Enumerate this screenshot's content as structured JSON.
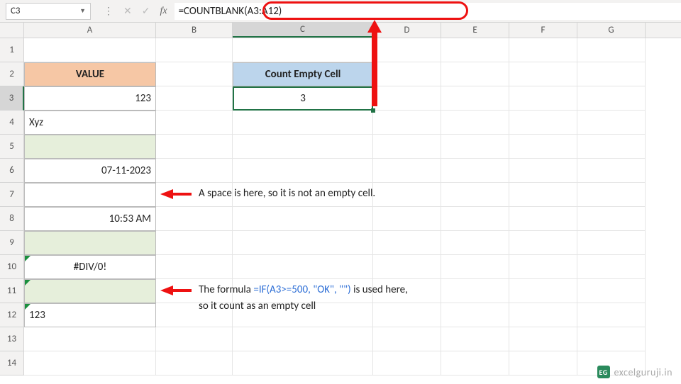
{
  "name_box": "C3",
  "formula_bar": "=COUNTBLANK(A3:A12)",
  "columns": [
    "A",
    "B",
    "C",
    "D",
    "E",
    "F",
    "G"
  ],
  "rows": [
    "1",
    "2",
    "3",
    "4",
    "5",
    "6",
    "7",
    "8",
    "9",
    "10",
    "11",
    "12",
    "13",
    "14"
  ],
  "headers": {
    "a2": "VALUE",
    "c2": "Count Empty Cell"
  },
  "cells": {
    "a3": "123",
    "a4": "Xyz",
    "a5": "",
    "a6": "07-11-2023",
    "a7": " ",
    "a8": "10:53 AM",
    "a9": "",
    "a10": "#DIV/0!",
    "a11": "",
    "a12": "123",
    "c3": "3"
  },
  "annotations": {
    "note1": "A space is here, so it is not an empty cell.",
    "note2_pre": "The formula ",
    "note2_formula": "=IF(A3>=500, \"OK\", \"\")",
    "note2_post": " is used here,",
    "note2_line2": "so it count as an empty cell"
  },
  "watermark": "excelguruji.in",
  "icons": {
    "dropdown": "▼",
    "sep": "⋮",
    "cancel": "✕",
    "accept": "✓",
    "fx": "fx"
  },
  "chart_data": null
}
